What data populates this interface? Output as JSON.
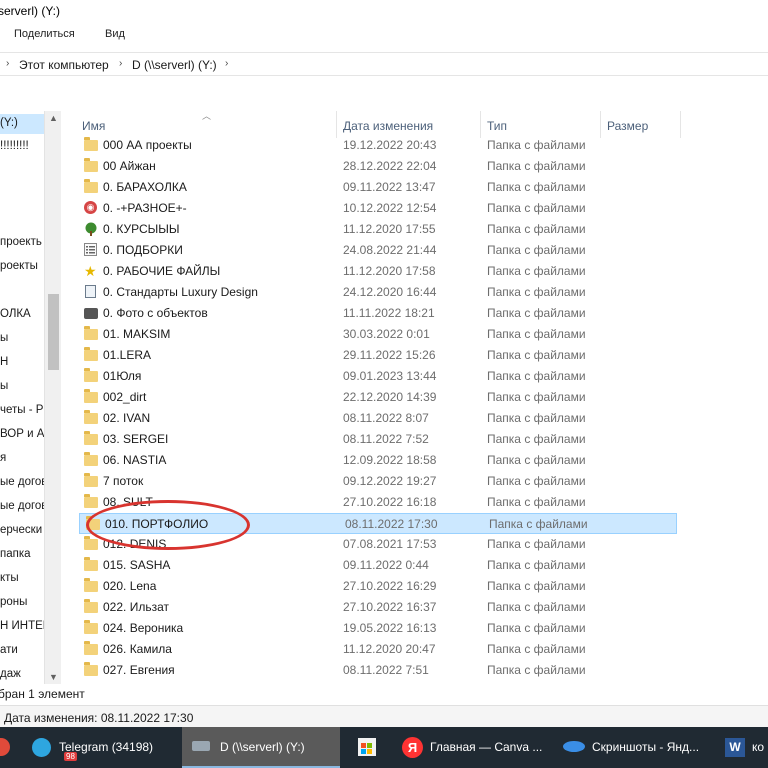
{
  "window": {
    "title": "serverl) (Y:)"
  },
  "ribbon": {
    "share_label": "Поделиться",
    "view_label": "Вид"
  },
  "address": {
    "crumb_pc": "Этот компьютер",
    "crumb_drive": "D (\\\\serverl) (Y:)"
  },
  "nav": {
    "items": [
      {
        "label": "(Y:)"
      },
      {
        "label": "!!!!!!!!!"
      },
      {
        "label": "проекть"
      },
      {
        "label": "роекты"
      },
      {
        "label": "ОЛКА"
      },
      {
        "label": "ы"
      },
      {
        "label": "Н"
      },
      {
        "label": "ы"
      },
      {
        "label": "четы - Р"
      },
      {
        "label": "ВОР и АІ"
      },
      {
        "label": "я"
      },
      {
        "label": "ые догов"
      },
      {
        "label": "ые догов"
      },
      {
        "label": "ерчески"
      },
      {
        "label": " папка"
      },
      {
        "label": "кты"
      },
      {
        "label": "роны"
      },
      {
        "label": "Н ИНТЕР"
      },
      {
        "label": "ати"
      },
      {
        "label": "даж"
      }
    ]
  },
  "columns": {
    "name": "Имя",
    "date": "Дата изменения",
    "type": "Тип",
    "size": "Размер"
  },
  "files": [
    {
      "name": "000 АА проекты",
      "date": "19.12.2022 20:43",
      "type": "Папка с файлами",
      "icon": "folder-icon"
    },
    {
      "name": "00 Айжан",
      "date": "28.12.2022 22:04",
      "type": "Папка с файлами",
      "icon": "folder-icon"
    },
    {
      "name": "0.  БАРАХОЛКА",
      "date": "09.11.2022 13:47",
      "type": "Папка с файлами",
      "icon": "folder-icon"
    },
    {
      "name": "0. -+РАЗНОЕ+-",
      "date": "10.12.2022 12:54",
      "type": "Папка с файлами",
      "icon": "red-circle-icon"
    },
    {
      "name": "0. КУРСЫЫЫ",
      "date": "11.12.2020 17:55",
      "type": "Папка с файлами",
      "icon": "tree-icon"
    },
    {
      "name": "0. ПОДБОРКИ",
      "date": "24.08.2022 21:44",
      "type": "Папка с файлами",
      "icon": "list-icon"
    },
    {
      "name": "0. РАБОЧИЕ ФАЙЛЫ",
      "date": "11.12.2020 17:58",
      "type": "Папка с файлами",
      "icon": "star-icon"
    },
    {
      "name": "0. Стандарты Luxury Design",
      "date": "24.12.2020 16:44",
      "type": "Папка с файлами",
      "icon": "document-icon"
    },
    {
      "name": "0. Фото с объектов",
      "date": "11.11.2022 18:21",
      "type": "Папка с файлами",
      "icon": "camera-icon"
    },
    {
      "name": "01. MAKSIM",
      "date": "30.03.2022 0:01",
      "type": "Папка с файлами",
      "icon": "folder-icon"
    },
    {
      "name": "01.LERA",
      "date": "29.11.2022 15:26",
      "type": "Папка с файлами",
      "icon": "folder-icon"
    },
    {
      "name": "01Юля",
      "date": "09.01.2023 13:44",
      "type": "Папка с файлами",
      "icon": "folder-icon"
    },
    {
      "name": "002_dirt",
      "date": "22.12.2020 14:39",
      "type": "Папка с файлами",
      "icon": "folder-icon"
    },
    {
      "name": "02. IVAN",
      "date": "08.11.2022 8:07",
      "type": "Папка с файлами",
      "icon": "folder-icon"
    },
    {
      "name": "03. SERGEI",
      "date": "08.11.2022 7:52",
      "type": "Папка с файлами",
      "icon": "folder-icon"
    },
    {
      "name": "06. NASTIA",
      "date": "12.09.2022 18:58",
      "type": "Папка с файлами",
      "icon": "folder-icon"
    },
    {
      "name": "7 поток",
      "date": "09.12.2022 19:27",
      "type": "Папка с файлами",
      "icon": "folder-icon"
    },
    {
      "name": "08. SULT",
      "date": "27.10.2022 16:18",
      "type": "Папка с файлами",
      "icon": "folder-icon"
    },
    {
      "name": "010. ПОРТФОЛИО",
      "date": "08.11.2022 17:30",
      "type": "Папка с файлами",
      "icon": "folder-icon",
      "selected": true
    },
    {
      "name": "012. DENIS",
      "date": "07.08.2021 17:53",
      "type": "Папка с файлами",
      "icon": "folder-icon"
    },
    {
      "name": "015. SASHA",
      "date": "09.11.2022 0:44",
      "type": "Папка с файлами",
      "icon": "folder-icon"
    },
    {
      "name": "020. Lena",
      "date": "27.10.2022 16:29",
      "type": "Папка с файлами",
      "icon": "folder-icon"
    },
    {
      "name": "022. Ильзат",
      "date": "27.10.2022 16:37",
      "type": "Папка с файлами",
      "icon": "folder-icon"
    },
    {
      "name": "024. Вероника",
      "date": "19.05.2022 16:13",
      "type": "Папка с файлами",
      "icon": "folder-icon"
    },
    {
      "name": "026. Камила",
      "date": "11.12.2020 20:47",
      "type": "Папка с файлами",
      "icon": "folder-icon"
    },
    {
      "name": "027. Евгения",
      "date": "08.11.2022 7:51",
      "type": "Папка с файлами",
      "icon": "folder-icon"
    }
  ],
  "status": {
    "selection": "бран 1 элемент",
    "detail": "Дата изменения: 08.11.2022 17:30"
  },
  "taskbar": {
    "telegram": "Telegram (34198)",
    "telegram_badge": "98",
    "explorer": "D (\\\\serverl) (Y:)",
    "yandex": "Главная — Canva ...",
    "screens": "Скриншоты - Янд...",
    "word": "ко"
  },
  "colors": {
    "selection": "#cce8ff",
    "annotation": "#d8342f",
    "taskbar": "#202a33"
  }
}
